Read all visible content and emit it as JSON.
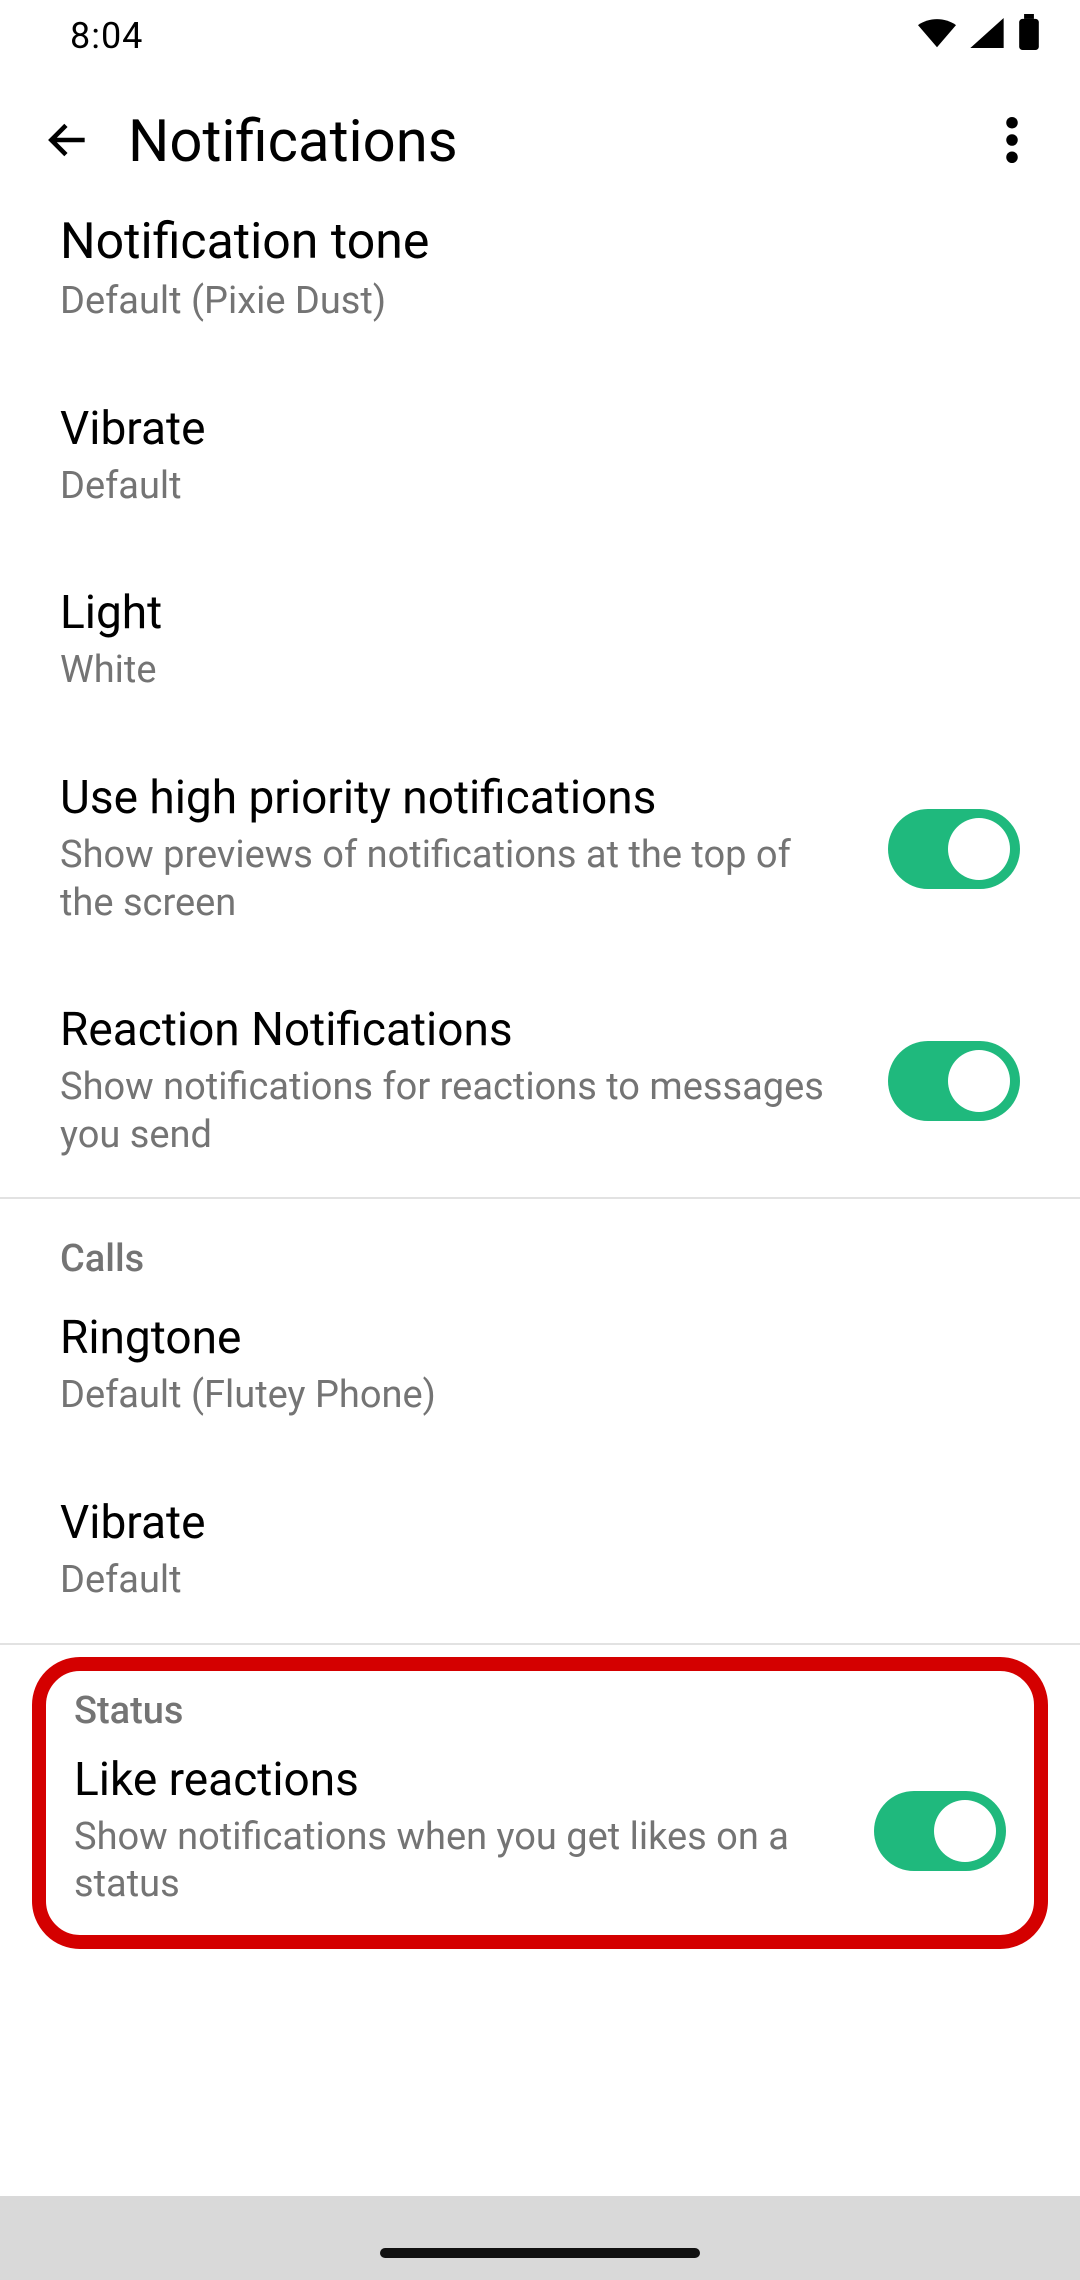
{
  "status": {
    "time": "8:04"
  },
  "header": {
    "title": "Notifications"
  },
  "messages": {
    "notification_tone": {
      "title": "Notification tone",
      "value": "Default (Pixie Dust)"
    },
    "vibrate": {
      "title": "Vibrate",
      "value": "Default"
    },
    "light": {
      "title": "Light",
      "value": "White"
    },
    "high_priority": {
      "title": "Use high priority notifications",
      "desc": "Show previews of notifications at the top of the screen",
      "enabled": true
    },
    "reaction": {
      "title": "Reaction Notifications",
      "desc": "Show notifications for reactions to messages you send",
      "enabled": true
    }
  },
  "calls": {
    "section": "Calls",
    "ringtone": {
      "title": "Ringtone",
      "value": "Default (Flutey Phone)"
    },
    "vibrate": {
      "title": "Vibrate",
      "value": "Default"
    }
  },
  "status_section": {
    "section": "Status",
    "like_reactions": {
      "title": "Like reactions",
      "desc": "Show notifications when you get likes on a status",
      "enabled": true
    }
  }
}
